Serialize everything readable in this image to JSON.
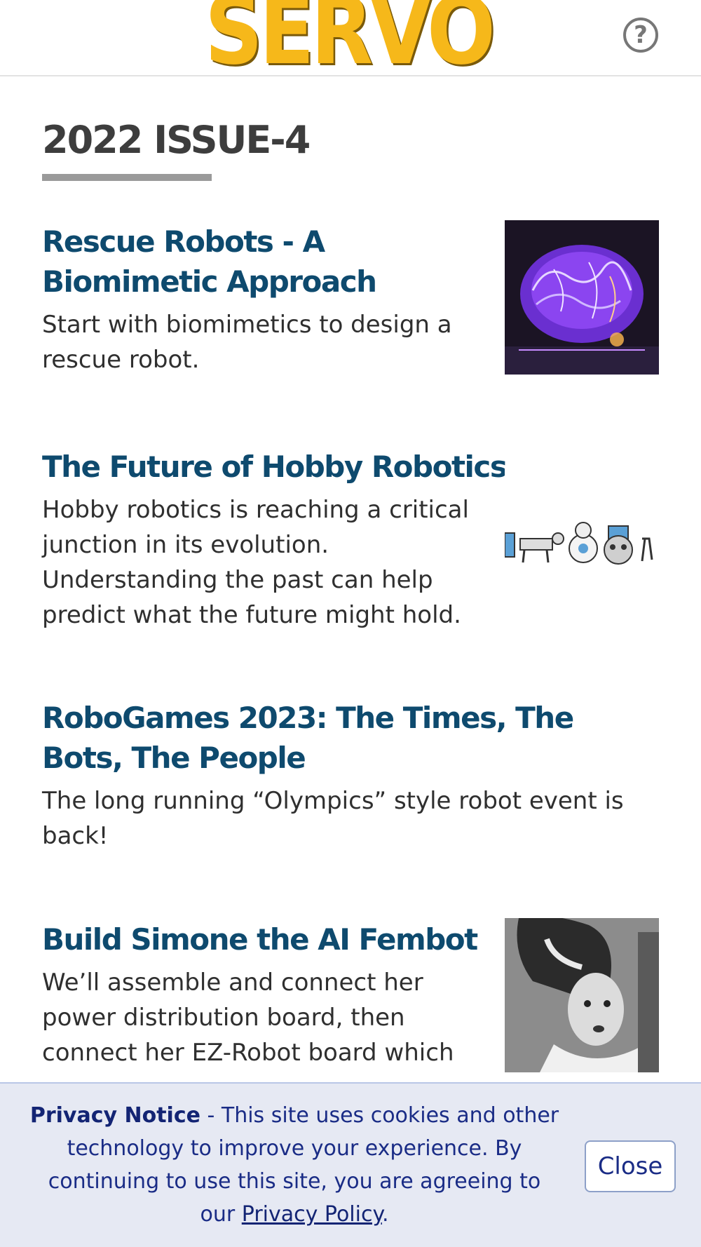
{
  "header": {
    "logo_text": "SERVO",
    "help_symbol": "?",
    "icon": "help-circle-icon",
    "brand_color": "#f6b81a"
  },
  "issue": {
    "title": "2022 ISSUE-4"
  },
  "articles": [
    {
      "title": "Rescue Robots - A Biomimetic Approach",
      "description": "Start with biomimetics to design a rescue robot.",
      "image": "glowing-brain-image"
    },
    {
      "title": "The Future of Hobby Robotics",
      "description": "Hobby robotics is reaching a critical junction in its evolution. Understanding the past can help predict what the future might hold.",
      "image": "robot-evolution-image"
    },
    {
      "title": "RoboGames 2023: The Times, The Bots, The People",
      "description": "The long running “Olympics” style robot event is back!"
    },
    {
      "title": "Build Simone the AI Fembot",
      "description": "We’ll assemble and connect her power distribution board, then connect her EZ-Robot board which",
      "image": "bride-of-frankenstein-image"
    }
  ],
  "privacy": {
    "heading": "Privacy Notice",
    "text": " - This site uses cookies and other technology to improve your experience. By continuing to use this site, you are agreeing to our ",
    "link_label": "Privacy Policy",
    "period": ".",
    "close_label": "Close"
  },
  "colors": {
    "title_blue": "#0e4a6e",
    "privacy_bg": "#e6e9f3",
    "privacy_text": "#1a2c86"
  }
}
